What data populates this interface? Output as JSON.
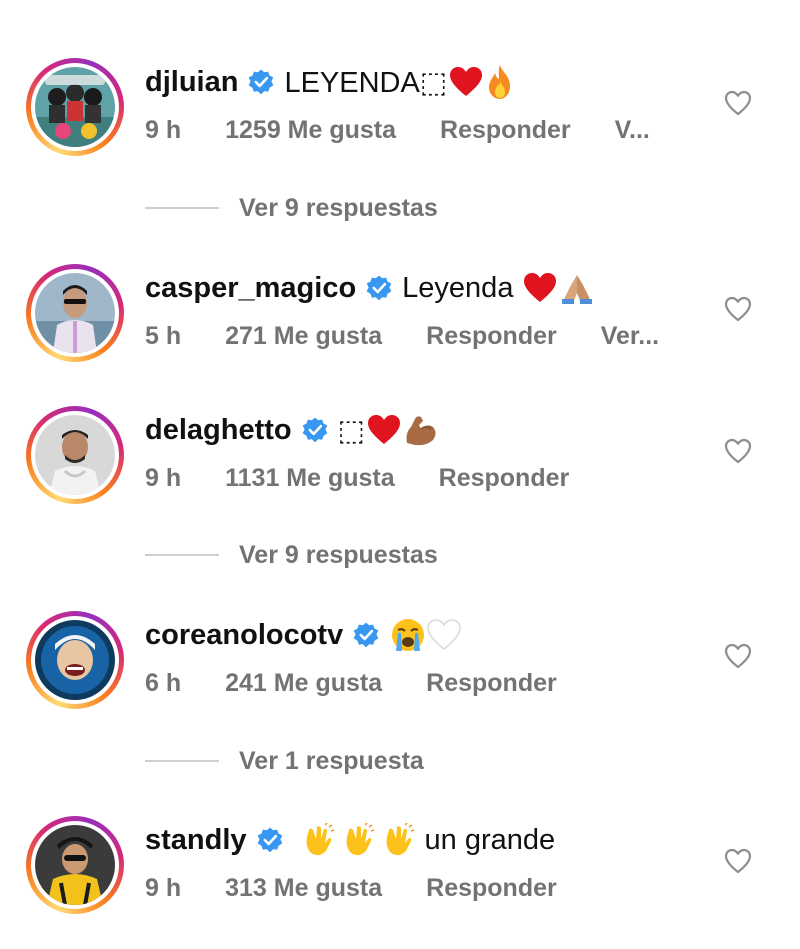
{
  "comments": [
    {
      "username": "djluian",
      "text": "LEYENDA⬚",
      "emoji": [
        "red-heart",
        "fire"
      ],
      "time": "9 h",
      "likes": "1259 Me gusta",
      "reply": "Responder",
      "extra": "V...",
      "replies_link": "Ver 9 respuestas"
    },
    {
      "username": "casper_magico",
      "text": "Leyenda",
      "emoji": [
        "red-heart",
        "folded-hands"
      ],
      "time": "5 h",
      "likes": "271 Me gusta",
      "reply": "Responder",
      "extra": "Ver...",
      "replies_link": ""
    },
    {
      "username": "delaghetto",
      "text": "⬚",
      "emoji": [
        "red-heart",
        "flexed-biceps"
      ],
      "time": "9 h",
      "likes": "1131 Me gusta",
      "reply": "Responder",
      "extra": "",
      "replies_link": "Ver 9 respuestas"
    },
    {
      "username": "coreanolocotv",
      "text": "",
      "emoji": [
        "crying-face",
        "white-heart"
      ],
      "time": "6 h",
      "likes": "241 Me gusta",
      "reply": "Responder",
      "extra": "",
      "replies_link": "Ver 1 respuesta"
    },
    {
      "username": "standly",
      "text": "un grande",
      "emoji": [
        "clapping-hands",
        "clapping-hands",
        "clapping-hands"
      ],
      "time": "9 h",
      "likes": "313 Me gusta",
      "reply": "Responder",
      "extra": "",
      "replies_link": ""
    }
  ],
  "colors": {
    "verified_blue": "#3897f0",
    "secondary_text": "#737373",
    "ring_gradient": [
      "#feda75",
      "#fa7e1e",
      "#d62976",
      "#962fbf"
    ]
  }
}
